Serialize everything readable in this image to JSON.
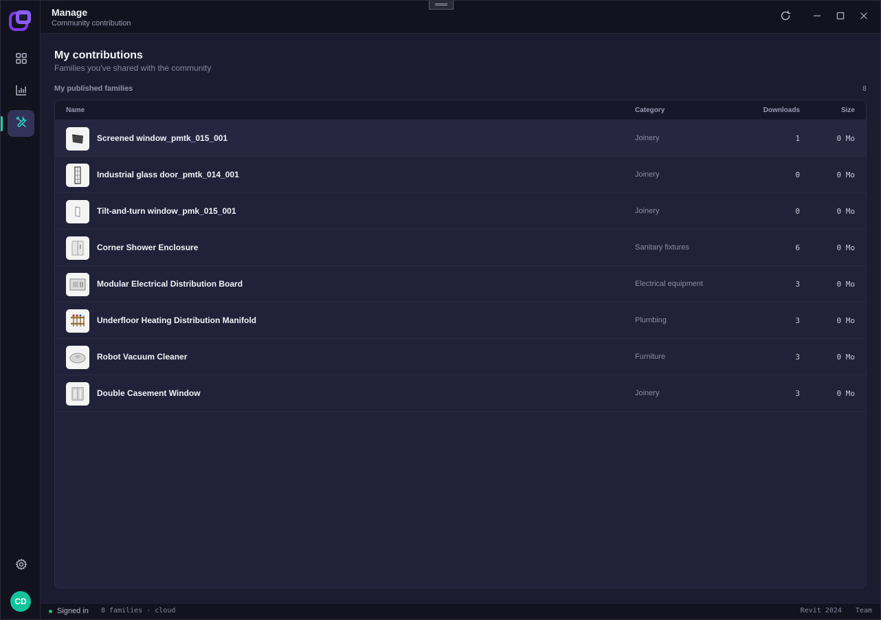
{
  "header": {
    "title": "Manage",
    "subtitle": "Community contribution"
  },
  "main": {
    "title": "My contributions",
    "subtitle": "Families you've shared with the community",
    "section_label": "My published families",
    "section_count": "8"
  },
  "table": {
    "columns": [
      "Name",
      "Category",
      "Downloads",
      "Size"
    ],
    "rows": [
      {
        "name": "Screened window_pmtk_015_001",
        "category": "Joinery",
        "downloads": "1",
        "size": "0 Mo",
        "thumb": "screened-window-icon"
      },
      {
        "name": "Industrial glass door_pmtk_014_001",
        "category": "Joinery",
        "downloads": "0",
        "size": "0 Mo",
        "thumb": "glass-door-icon"
      },
      {
        "name": "Tilt-and-turn window_pmk_015_001",
        "category": "Joinery",
        "downloads": "0",
        "size": "0 Mo",
        "thumb": "tilt-window-icon"
      },
      {
        "name": "Corner Shower Enclosure",
        "category": "Sanitary fixtures",
        "downloads": "6",
        "size": "0 Mo",
        "thumb": "shower-enclosure-icon"
      },
      {
        "name": "Modular Electrical Distribution Board",
        "category": "Electrical equipment",
        "downloads": "3",
        "size": "0 Mo",
        "thumb": "distribution-board-icon"
      },
      {
        "name": "Underfloor Heating Distribution Manifold",
        "category": "Plumbing",
        "downloads": "3",
        "size": "0 Mo",
        "thumb": "manifold-icon"
      },
      {
        "name": "Robot Vacuum Cleaner",
        "category": "Furniture",
        "downloads": "3",
        "size": "0 Mo",
        "thumb": "robot-vacuum-icon"
      },
      {
        "name": "Double Casement Window",
        "category": "Joinery",
        "downloads": "3",
        "size": "0 Mo",
        "thumb": "casement-window-icon"
      }
    ]
  },
  "sidebar": {
    "avatar_initials": "CD",
    "items": [
      {
        "name": "dashboard-grid-icon"
      },
      {
        "name": "statistics-chart-icon"
      },
      {
        "name": "tools-icon",
        "active": true
      }
    ]
  },
  "statusbar": {
    "status": "Signed in",
    "info": "8 families · cloud",
    "version": "Revit 2024",
    "plan": "Team"
  },
  "colors": {
    "accent": "#1fd1a8",
    "active_nav_bg": "#33335a",
    "status_ok": "#22c55e",
    "avatar": "#12c49c"
  }
}
